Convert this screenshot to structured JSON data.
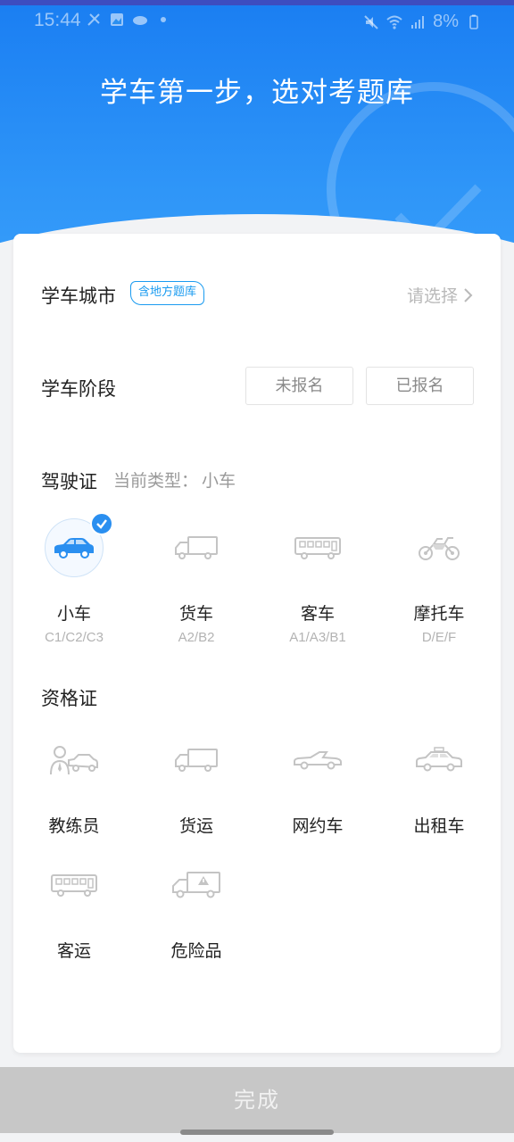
{
  "status_bar": {
    "time": "15:44",
    "battery": "8%"
  },
  "header": {
    "title": "学车第一步，选对考题库"
  },
  "city": {
    "label": "学车城市",
    "tag": "含地方题库",
    "placeholder": "请选择"
  },
  "stage": {
    "label": "学车阶段",
    "options": [
      "未报名",
      "已报名"
    ]
  },
  "license": {
    "label": "驾驶证",
    "current_prefix": "当前类型：",
    "current_value": "小车",
    "items": [
      {
        "name": "小车",
        "code": "C1/C2/C3",
        "icon": "car-icon",
        "selected": true
      },
      {
        "name": "货车",
        "code": "A2/B2",
        "icon": "truck-icon",
        "selected": false
      },
      {
        "name": "客车",
        "code": "A1/A3/B1",
        "icon": "bus-icon",
        "selected": false
      },
      {
        "name": "摩托车",
        "code": "D/E/F",
        "icon": "motorcycle-icon",
        "selected": false
      }
    ]
  },
  "qualification": {
    "label": "资格证",
    "items": [
      {
        "name": "教练员",
        "icon": "instructor-icon"
      },
      {
        "name": "货运",
        "icon": "cargo-truck-icon"
      },
      {
        "name": "网约车",
        "icon": "ride-hailing-car-icon"
      },
      {
        "name": "出租车",
        "icon": "taxi-icon"
      },
      {
        "name": "客运",
        "icon": "passenger-bus-icon"
      },
      {
        "name": "危险品",
        "icon": "hazmat-truck-icon"
      }
    ]
  },
  "footer": {
    "done_label": "完成"
  },
  "colors": {
    "brand_blue": "#1a7ef2",
    "accent": "#1a9bf0",
    "icon_gray": "#c4c4c4",
    "disabled_button": "#c7c7c7"
  }
}
